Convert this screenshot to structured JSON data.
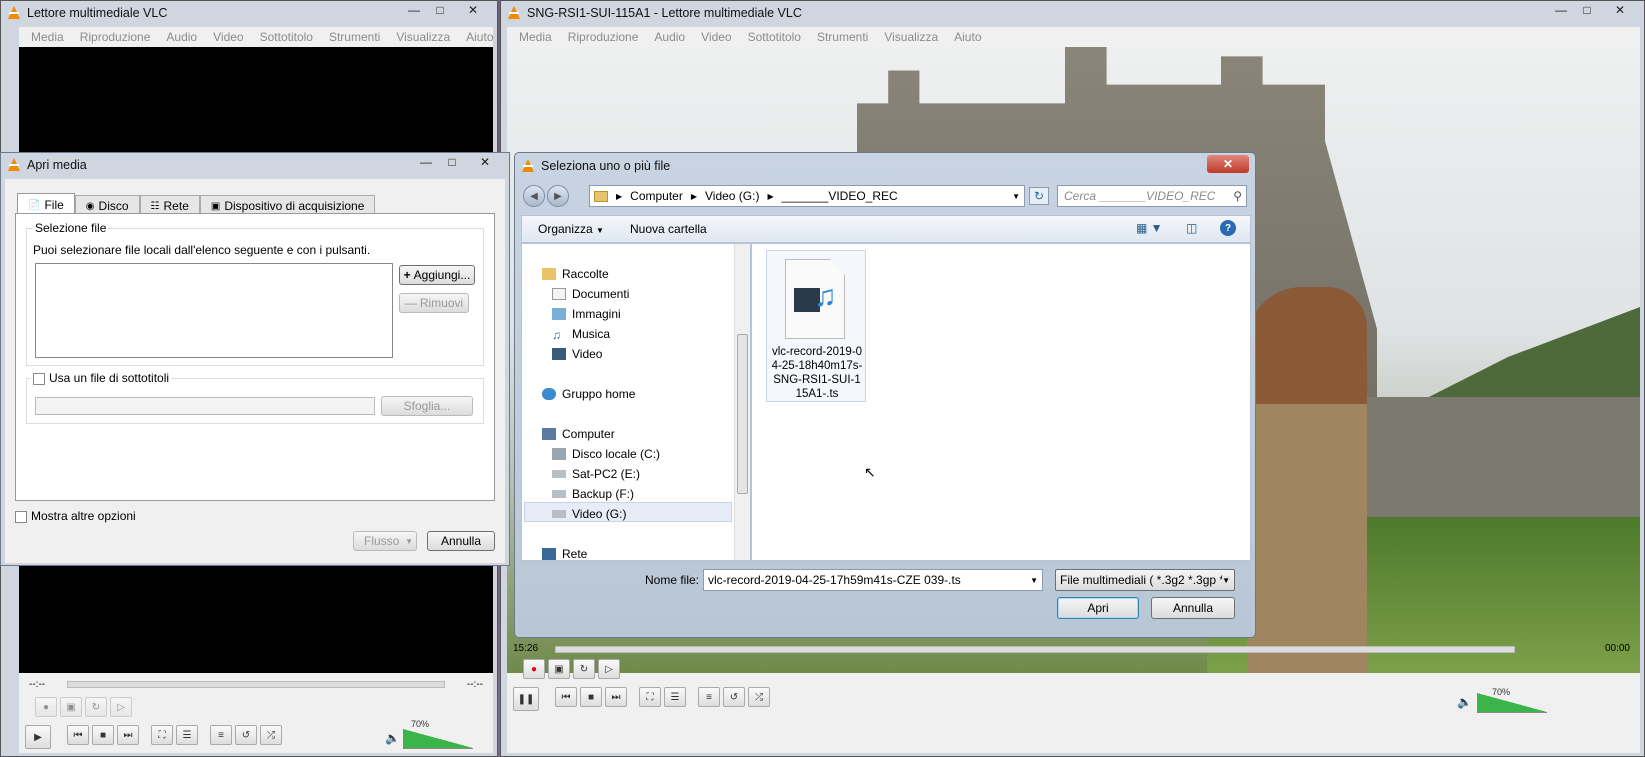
{
  "vlc_left": {
    "title": "Lettore multimediale VLC",
    "menu": [
      "Media",
      "Riproduzione",
      "Audio",
      "Video",
      "Sottotitolo",
      "Strumenti",
      "Visualizza",
      "Aiuto"
    ],
    "time_left": "--:--",
    "time_right": "--:--",
    "volume": "70%"
  },
  "vlc_right": {
    "title": "SNG-RSI1-SUI-115A1 - Lettore multimediale VLC",
    "menu": [
      "Media",
      "Riproduzione",
      "Audio",
      "Video",
      "Sottotitolo",
      "Strumenti",
      "Visualizza",
      "Aiuto"
    ],
    "time_left": "15:26",
    "time_right": "00:00",
    "volume": "70%"
  },
  "open_media": {
    "title": "Apri media",
    "tabs": [
      "File",
      "Disco",
      "Rete",
      "Dispositivo di acquisizione"
    ],
    "section_label": "Selezione file",
    "description": "Puoi selezionare file locali dall'elenco seguente e con i pulsanti.",
    "add_button": "Aggiungi...",
    "remove_button": "Rimuovi",
    "subtitle_label": "Usa un file di sottotitoli",
    "browse_button": "Sfoglia...",
    "more_options": "Mostra altre opzioni",
    "stream_button": "Flusso",
    "cancel_button": "Annulla"
  },
  "file_dialog": {
    "title": "Seleziona uno o più file",
    "breadcrumb": [
      "Computer",
      "Video (G:)",
      "_______VIDEO_REC"
    ],
    "search_placeholder": "Cerca _______VIDEO_REC",
    "organize": "Organizza",
    "new_folder": "Nuova cartella",
    "nav": {
      "raccolte": "Raccolte",
      "documenti": "Documenti",
      "immagini": "Immagini",
      "musica": "Musica",
      "video": "Video",
      "gruppo": "Gruppo home",
      "computer": "Computer",
      "disco_c": "Disco locale (C:)",
      "sat": "Sat-PC2 (E:)",
      "backup": "Backup (F:)",
      "video_g": "Video (G:)",
      "rete": "Rete"
    },
    "file_name": "vlc-record-2019-04-25-18h40m17s-SNG-RSI1-SUI-115A1-.ts",
    "filename_label": "Nome file:",
    "filename_value": "vlc-record-2019-04-25-17h59m41s-CZE 039-.ts",
    "filetype": "File multimediali ( *.3g2 *.3gp *",
    "open_button": "Apri",
    "cancel_button": "Annulla"
  }
}
